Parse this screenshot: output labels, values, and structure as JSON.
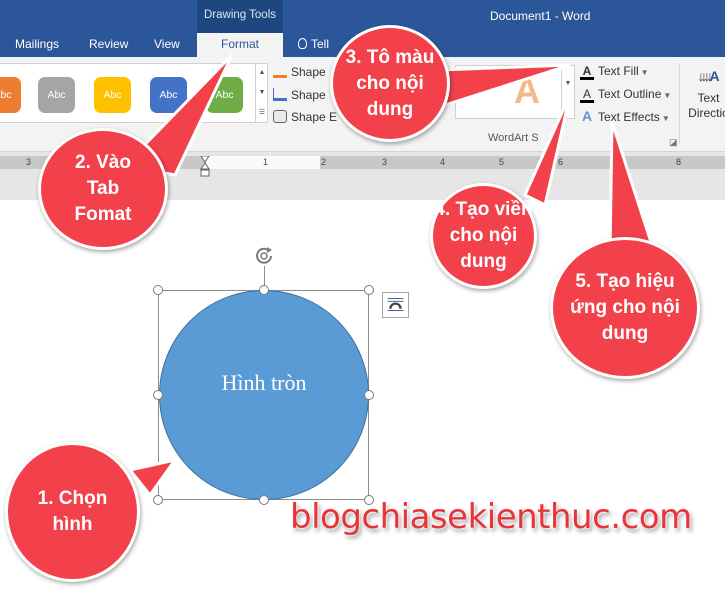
{
  "window": {
    "title": "Document1 - Word",
    "context_group": "Drawing Tools"
  },
  "tabs": [
    {
      "label": "Mailings",
      "active": false
    },
    {
      "label": "Review",
      "active": false
    },
    {
      "label": "View",
      "active": false
    },
    {
      "label": "Format",
      "active": true
    },
    {
      "label": "Tell",
      "active": false
    }
  ],
  "ribbon": {
    "shape_styles": [
      {
        "label": "Abc",
        "color": "#ed7d31"
      },
      {
        "label": "Abc",
        "color": "#a5a5a5"
      },
      {
        "label": "Abc",
        "color": "#ffc000"
      },
      {
        "label": "Abc",
        "color": "#4472c4"
      },
      {
        "label": "Abc",
        "color": "#70ad47"
      }
    ],
    "shape_commands": [
      {
        "label": "Shape",
        "icon": "paint-bucket-icon"
      },
      {
        "label": "Shape",
        "icon": "pen-outline-icon"
      },
      {
        "label": "Shape E",
        "icon": "shape-effects-icon"
      }
    ],
    "wordart_letter": "A",
    "wordart_group_label": "WordArt S",
    "text_commands": [
      {
        "label": "Text Fill",
        "glyph": "A"
      },
      {
        "label": "Text Outline",
        "glyph": "A"
      },
      {
        "label": "Text Effects",
        "glyph": "A"
      }
    ],
    "text_direction": {
      "line1": "Text",
      "line2": "Directio"
    }
  },
  "ruler": {
    "numbers": [
      "3",
      "1",
      "2",
      "3",
      "4",
      "5",
      "6",
      "8"
    ]
  },
  "document": {
    "shape_text": "Hình tròn",
    "shape_fill": "#5b9bd5"
  },
  "callouts": [
    {
      "id": "step-1",
      "text": "1. Chọn hình"
    },
    {
      "id": "step-2",
      "text": "2. Vào Tab Fomat"
    },
    {
      "id": "step-3",
      "text": "3. Tô màu cho nội dung"
    },
    {
      "id": "step-4",
      "text": "4. Tạo viền cho nội dung"
    },
    {
      "id": "step-5",
      "text": "5. Tạo hiệu ứng cho nội dung"
    }
  ],
  "callout_color": "#f2414a",
  "watermark": "blogchiasekienthuc.com"
}
